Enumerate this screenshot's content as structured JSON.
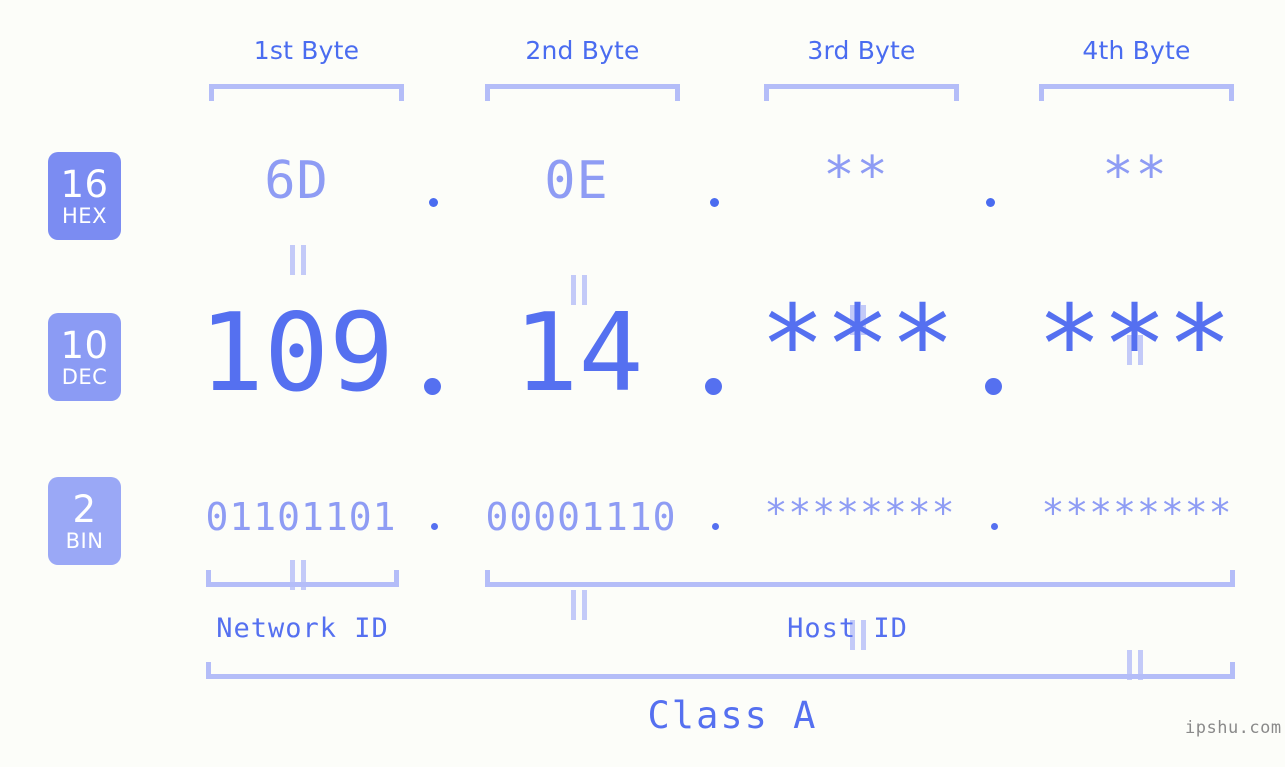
{
  "watermark": "ipshu.com",
  "byte_headers": [
    {
      "label": "1st Byte"
    },
    {
      "label": "2nd Byte"
    },
    {
      "label": "3rd Byte"
    },
    {
      "label": "4th Byte"
    }
  ],
  "radix_rows": [
    {
      "number": "16",
      "system": "HEX",
      "color": "#7b8cf2"
    },
    {
      "number": "10",
      "system": "DEC",
      "color": "#8b9bf4"
    },
    {
      "number": "2",
      "system": "BIN",
      "color": "#9aa8f6"
    }
  ],
  "rows": {
    "hex": {
      "values": [
        "6D",
        "0E",
        "**",
        "**"
      ],
      "separator": "."
    },
    "dec": {
      "values": [
        "109",
        "14",
        "***",
        "***"
      ],
      "separator": "."
    },
    "bin": {
      "values": [
        "01101101",
        "00001110",
        "********",
        "********"
      ],
      "separator": "."
    }
  },
  "connector_symbol": "=",
  "regions": [
    {
      "label": "Network ID"
    },
    {
      "label": "Host ID"
    }
  ],
  "class": {
    "label": "Class A"
  },
  "colors": {
    "background": "#fcfdf9",
    "bracket": "#b4bdf8",
    "accent": "#5570f0",
    "muted": "#8e9cf4",
    "connector": "#c3caf8",
    "watermark": "#8a8a8a"
  }
}
